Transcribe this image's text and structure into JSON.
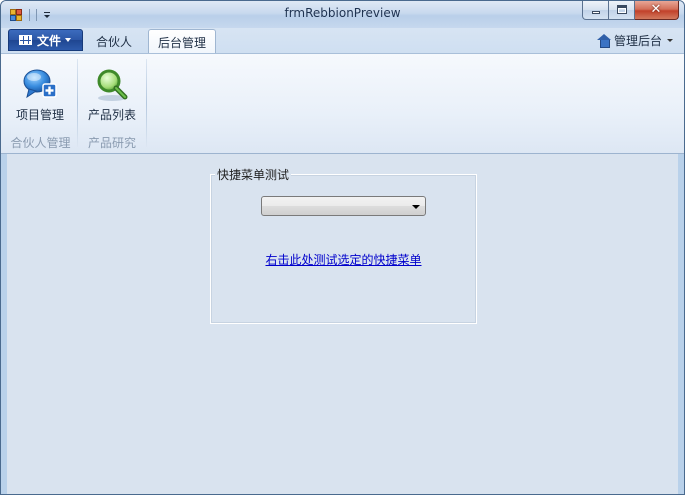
{
  "window": {
    "title": "frmRebbionPreview"
  },
  "ribbon": {
    "file_tab": {
      "label": "文件"
    },
    "tabs": [
      {
        "label": "合伙人",
        "selected": false
      },
      {
        "label": "后台管理",
        "selected": true
      }
    ],
    "right_button": {
      "label": "管理后台",
      "icon": "home-icon"
    },
    "groups": [
      {
        "label": "合伙人管理",
        "buttons": [
          {
            "label": "项目管理",
            "icon": "chat-add-icon"
          }
        ]
      },
      {
        "label": "产品研究",
        "buttons": [
          {
            "label": "产品列表",
            "icon": "magnifier-icon"
          }
        ]
      }
    ]
  },
  "main": {
    "groupbox": {
      "title": "快捷菜单测试",
      "combo_value": "",
      "link_text": "右击此处测试选定的快捷菜单"
    }
  },
  "colors": {
    "file_tab": "#2b56a6",
    "window_frame": "#b9d1ea",
    "content_bg": "#d9e3ef",
    "link": "#0000cc"
  }
}
